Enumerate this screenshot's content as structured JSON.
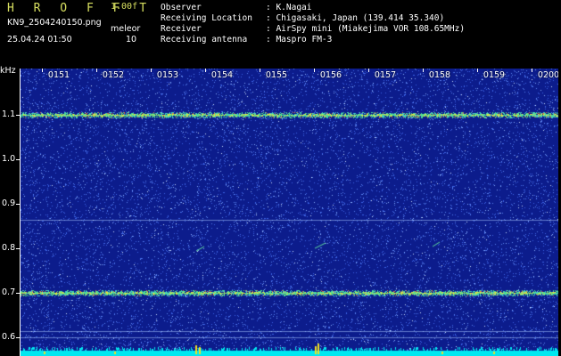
{
  "header": {
    "app_title": "H R O F F T",
    "version": "1.00f",
    "file_name": "KN9_2504240150.png",
    "date_time": "25.04.24 01:50",
    "mode_label": "meleor",
    "mode_value": "10"
  },
  "info": [
    {
      "label": "Observer",
      "value": ": K.Nagai"
    },
    {
      "label": "Receiving Location",
      "value": ": Chigasaki, Japan (139.414 35.340)"
    },
    {
      "label": "Receiver",
      "value": ": AirSpy mini (Miakejima VOR 108.65MHz)"
    },
    {
      "label": "Receiving antenna",
      "value": ": Maspro FM-3"
    }
  ],
  "plot": {
    "y_unit": "kHz",
    "y_labels": [
      "1.1",
      "1.0",
      "0.9",
      "0.8",
      "0.7",
      "0.6"
    ],
    "x_labels": [
      "0151",
      "0152",
      "0153",
      "0154",
      "0155",
      "0156",
      "0157",
      "0158",
      "0159",
      "0200"
    ],
    "colors": {
      "background": "#0c1c8c",
      "noise": "#3c64e6",
      "band": "#50e090",
      "band_core": "#e8e040",
      "floor": "#00e8f0",
      "spike": "#f0e020"
    }
  }
}
